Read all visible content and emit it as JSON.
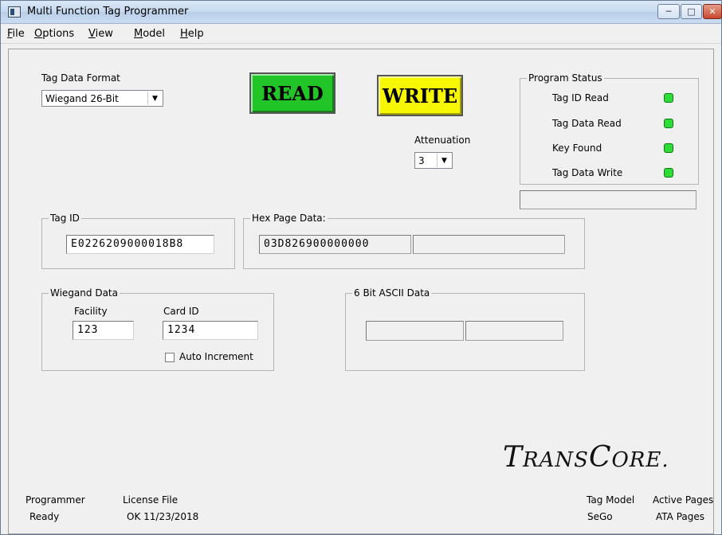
{
  "window": {
    "title": "Multi Function Tag Programmer"
  },
  "menu": {
    "items": [
      "File",
      "Options",
      "View",
      "Model",
      "Help"
    ]
  },
  "tag_format": {
    "label": "Tag Data Format",
    "selected": "Wiegand 26-Bit"
  },
  "buttons": {
    "read": "READ",
    "write": "WRITE"
  },
  "attenuation": {
    "label": "Attenuation",
    "selected": "3"
  },
  "program_status": {
    "title": "Program Status",
    "items": [
      {
        "label": "Tag ID Read",
        "color": "#2edb37"
      },
      {
        "label": "Tag Data Read",
        "color": "#2edb37"
      },
      {
        "label": "Key Found",
        "color": "#2edb37"
      },
      {
        "label": "Tag Data Write",
        "color": "#2edb37"
      }
    ]
  },
  "tag_id": {
    "title": "Tag ID",
    "value": "E0226209000018B8"
  },
  "hex_page": {
    "title": "Hex Page Data:",
    "value1": "03D826900000000",
    "value2": ""
  },
  "wiegand": {
    "title": "Wiegand Data",
    "facility_label": "Facility",
    "facility_value": "123",
    "card_label": "Card ID",
    "card_value": "1234",
    "auto_increment_label": "Auto Increment",
    "auto_increment_checked": false
  },
  "ascii": {
    "title": "6 Bit ASCII Data",
    "value1": "",
    "value2": ""
  },
  "logo": {
    "first": "T",
    "rest1": "RANS",
    "second": "C",
    "rest2": "ORE."
  },
  "status_bar": {
    "programmer_label": "Programmer",
    "programmer_value": "Ready",
    "license_label": "License File",
    "license_value": "OK 11/23/2018",
    "tag_model_label": "Tag Model",
    "tag_model_value": "SeGo",
    "active_pages_label": "Active Pages",
    "active_pages_value": "ATA Pages"
  }
}
